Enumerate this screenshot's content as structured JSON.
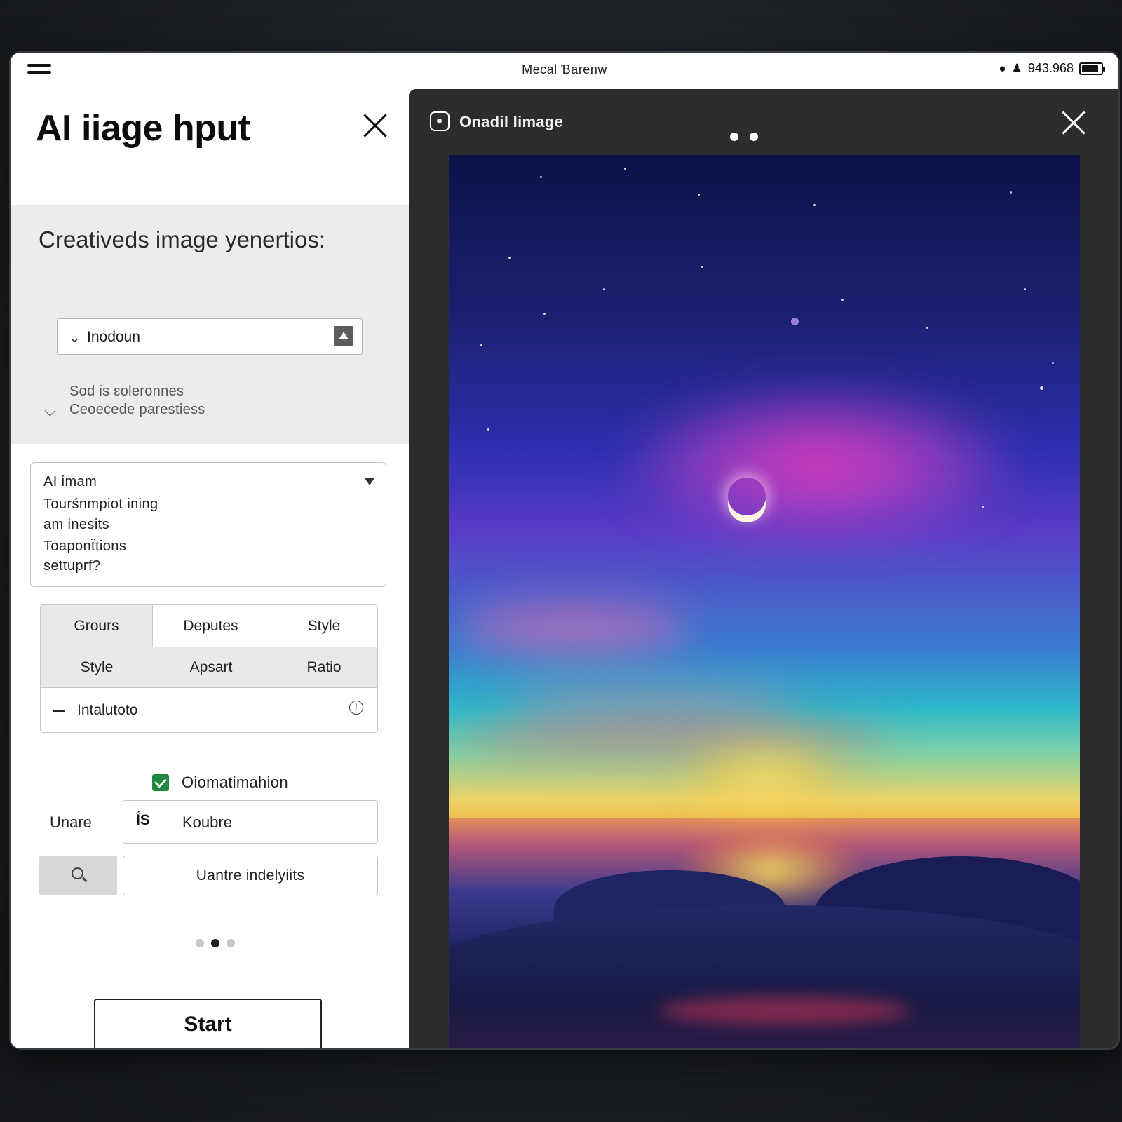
{
  "status_bar": {
    "title": "Mecal Ɓarenw",
    "number": "943.968"
  },
  "left_panel": {
    "title": "AI iiage hput",
    "section_title": "Creativeds image yenertios:",
    "dropdown": {
      "label": "Inodoun"
    },
    "hint_line1": "Sod is ɛoleronnes",
    "hint_line2": "Ceoecede parestiess",
    "prompt": {
      "lines": [
        "AI imam",
        "Tourśnmpiot ining",
        "am inesits",
        "Toaponẗtions",
        "settuprf?"
      ]
    },
    "options": {
      "row1": [
        "Grours",
        "Deputes",
        "Style"
      ],
      "row2": [
        "Style",
        "Apsart",
        "Ratio"
      ],
      "auto_label": "Intalutoto"
    },
    "checkbox_label": "Oiomatimahion",
    "name_label": "Unare",
    "name_glyph": "ḮЅ",
    "name_value": "Koubre",
    "search_value": "Uantre indelyiits",
    "start_label": "Start"
  },
  "right_panel": {
    "title": "Onadil Iimage"
  },
  "colors": {
    "accent_check": "#1e8a3f",
    "panel_dark": "#2c2c2e"
  }
}
